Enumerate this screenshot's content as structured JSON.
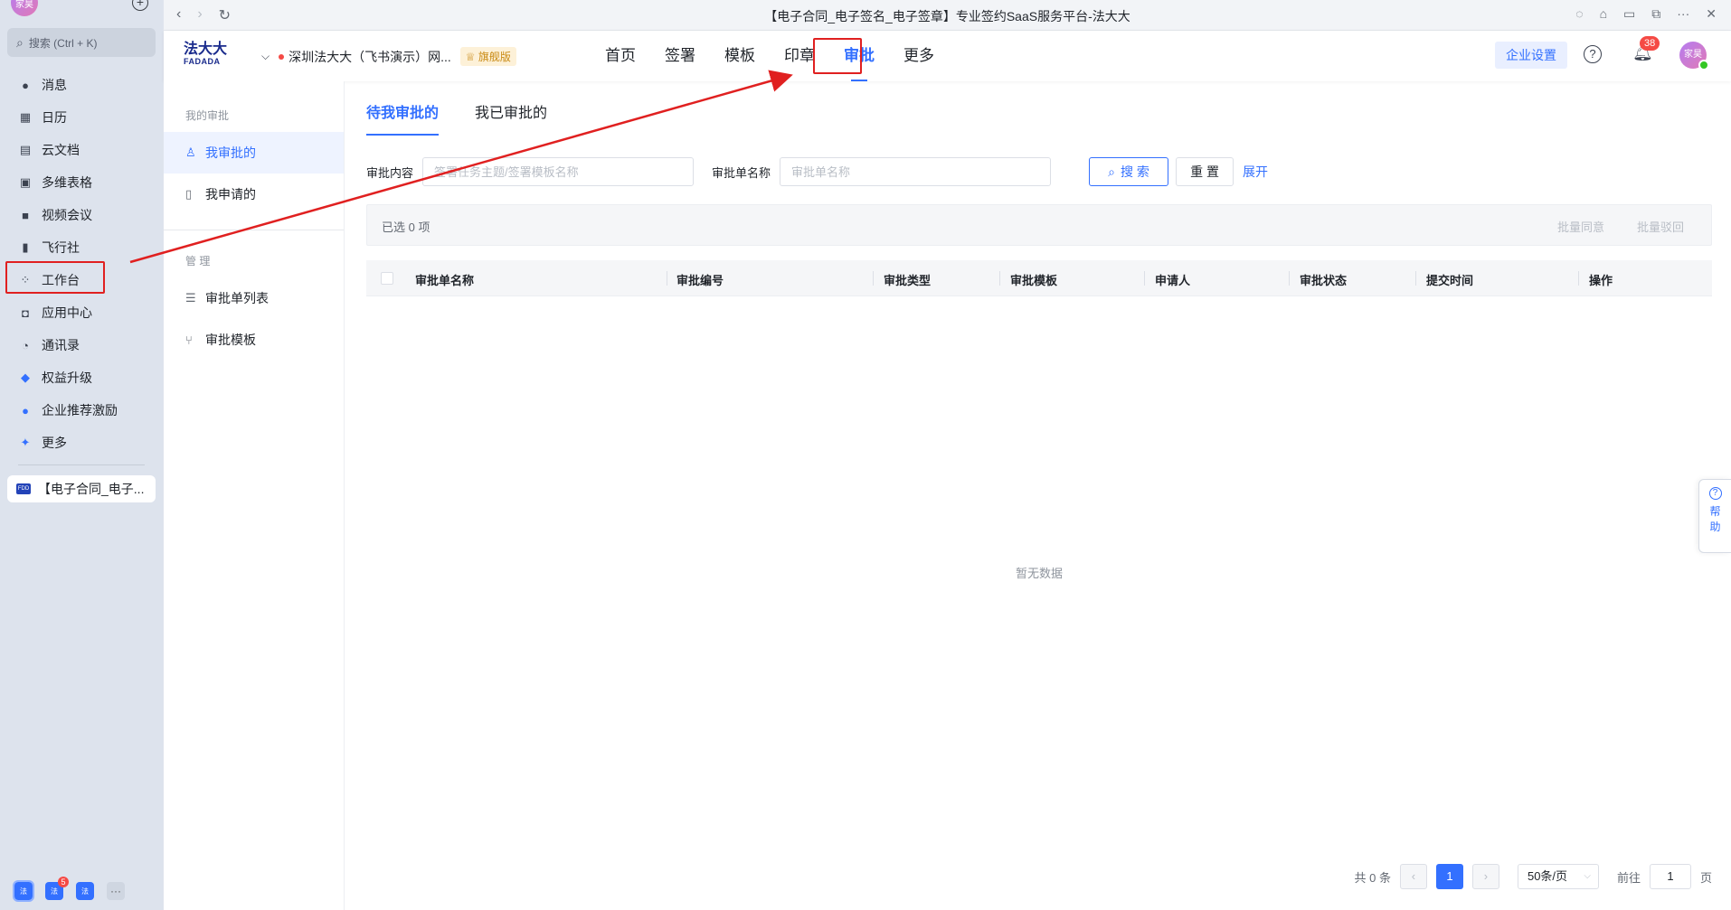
{
  "feishu": {
    "avatar_text": "家昊",
    "search_label": "搜索 (Ctrl + K)",
    "nav": [
      {
        "label": "消息",
        "icon": "chat-bubble-icon"
      },
      {
        "label": "日历",
        "icon": "calendar-icon"
      },
      {
        "label": "云文档",
        "icon": "docs-icon"
      },
      {
        "label": "多维表格",
        "icon": "table-icon"
      },
      {
        "label": "视频会议",
        "icon": "video-icon"
      },
      {
        "label": "飞行社",
        "icon": "book-icon"
      },
      {
        "label": "工作台",
        "icon": "grid-icon"
      },
      {
        "label": "应用中心",
        "icon": "bag-icon"
      },
      {
        "label": "通讯录",
        "icon": "contacts-icon"
      },
      {
        "label": "权益升级",
        "icon": "diamond-icon"
      },
      {
        "label": "企业推荐激励",
        "icon": "people-icon"
      },
      {
        "label": "更多",
        "icon": "apps-more-icon"
      }
    ],
    "pinned_app": "【电子合同_电子...",
    "bottom_badge": "5",
    "bottom_icon_text": "法"
  },
  "window": {
    "title": "【电子合同_电子签名_电子签章】专业签约SaaS服务平台-法大大"
  },
  "header": {
    "brand_cn": "法大大",
    "brand_en": "FADADA",
    "company": "深圳法大大（飞书演示）网...",
    "edition_tag": "旗舰版",
    "nav": [
      "首页",
      "签署",
      "模板",
      "印章",
      "审批",
      "更多"
    ],
    "active_nav": "审批",
    "enterprise_settings": "企业设置",
    "notification_count": "38",
    "user_avatar_text": "家昊"
  },
  "submenu": {
    "group1": "我的审批",
    "items1": [
      "我审批的",
      "我申请的"
    ],
    "group2": "管 理",
    "items2": [
      "审批单列表",
      "审批模板"
    ]
  },
  "main": {
    "tabs": [
      "待我审批的",
      "我已审批的"
    ],
    "filter1_label": "审批内容",
    "filter1_placeholder": "签署任务主题/签署模板名称",
    "filter2_label": "审批单名称",
    "filter2_placeholder": "审批单名称",
    "search_btn": "搜 索",
    "reset_btn": "重 置",
    "expand_link": "展开",
    "selected_text": "已选 0 项",
    "batch_approve": "批量同意",
    "batch_reject": "批量驳回",
    "columns": [
      "审批单名称",
      "审批编号",
      "审批类型",
      "审批模板",
      "申请人",
      "审批状态",
      "提交时间",
      "操作"
    ],
    "empty_text": "暂无数据"
  },
  "pagination": {
    "total": "共 0 条",
    "current_page": "1",
    "page_size": "50条/页",
    "goto_label": "前往",
    "goto_value": "1",
    "page_suffix": "页"
  },
  "help_float": {
    "line1": "帮",
    "line2": "助"
  },
  "colors": {
    "accent": "#3370ff",
    "annotation_red": "#e02020"
  }
}
